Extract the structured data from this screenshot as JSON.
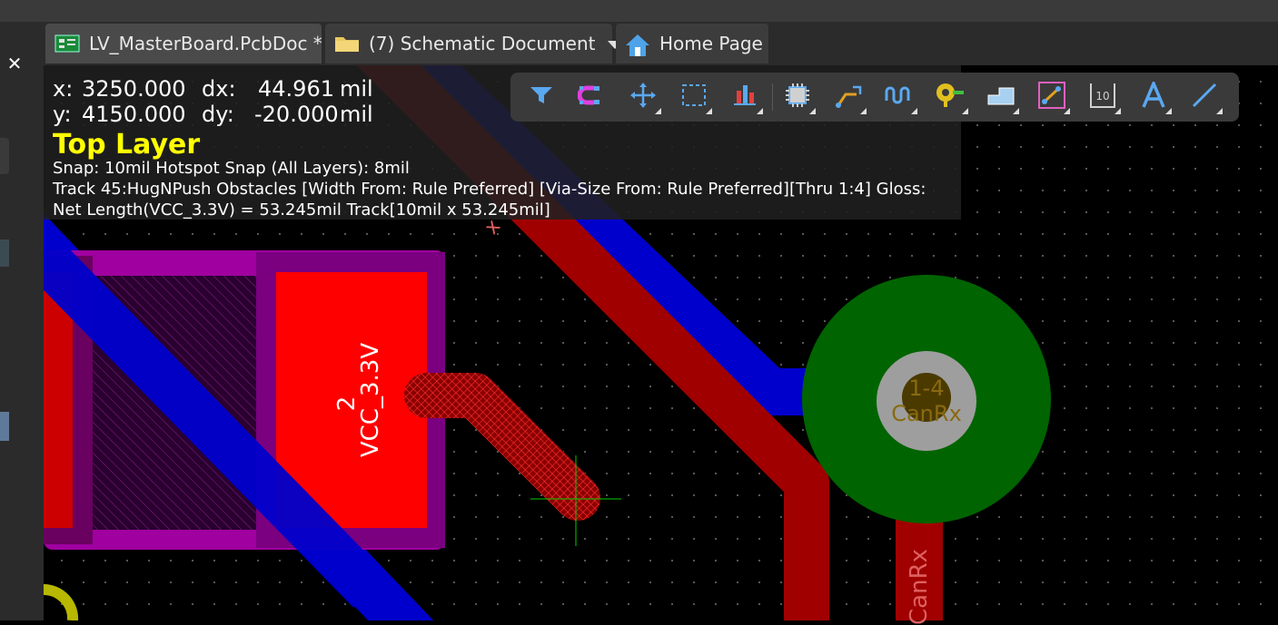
{
  "window": {
    "close_label": "✕"
  },
  "tabs": [
    {
      "label": "LV_MasterBoard.PcbDoc *",
      "icon": "pcb-document-icon",
      "active": true
    },
    {
      "label": "(7) Schematic Document",
      "icon": "folder-icon",
      "has_dropdown": true
    },
    {
      "label": "Home Page",
      "icon": "home-icon"
    }
  ],
  "hud": {
    "x_label": "x:",
    "x_value": "3250.000",
    "dx_label": "dx:",
    "dx_value": "44.961",
    "dx_unit": "mil",
    "y_label": "y:",
    "y_value": "4150.000",
    "dy_label": "dy:",
    "dy_value": "-20.000",
    "dy_unit": "mil",
    "layer": "Top Layer",
    "snap_line": "Snap: 10mil Hotspot Snap (All Layers): 8mil",
    "track_line": "Track 45:HugNPush Obstacles [Width From: Rule Preferred] [Via-Size From: Rule Preferred][Thru 1:4] Gloss:",
    "net_line": "Net Length(VCC_3.3V) = 53.245mil Track[10mil x 53.245mil]",
    "layer_color": "#ffff00"
  },
  "toolbar": {
    "buttons": [
      {
        "icon": "filter-icon"
      },
      {
        "icon": "snap-magnet-icon"
      },
      {
        "icon": "move-crosshair-icon"
      },
      {
        "icon": "select-rectangle-icon"
      },
      {
        "icon": "align-icon"
      },
      {
        "icon": "place-component-icon"
      },
      {
        "icon": "interactive-routing-icon"
      },
      {
        "icon": "length-tuning-icon"
      },
      {
        "icon": "place-via-icon"
      },
      {
        "icon": "polygon-pour-icon"
      },
      {
        "icon": "place-track-icon"
      },
      {
        "icon": "place-dimension-icon"
      },
      {
        "icon": "place-string-icon"
      },
      {
        "icon": "place-line-icon"
      }
    ]
  },
  "board": {
    "pad_number": "2",
    "pad_net": "VCC_3.3V",
    "via_number": "1-4",
    "via_net": "CanRx",
    "track_net_label": "CanRx",
    "trace_char": "x",
    "colors": {
      "top_layer": "#cc0000",
      "bottom_layer": "#0000cc",
      "pad": "#ff0000",
      "overlay": "#a000a0",
      "via_ring": "#006400",
      "via_hole": "#9e9e9e"
    }
  }
}
